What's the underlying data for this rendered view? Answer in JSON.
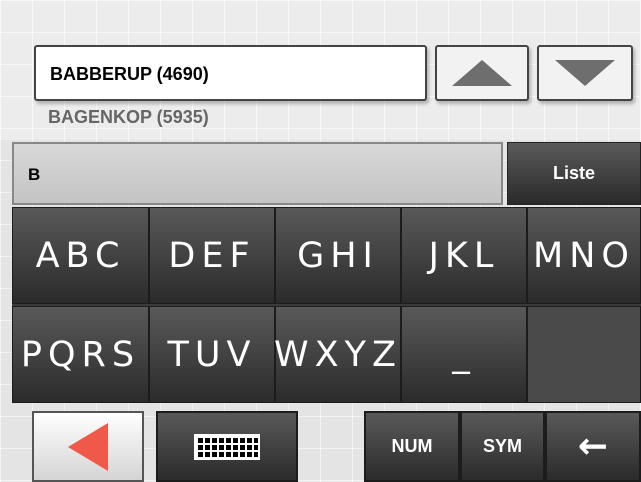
{
  "search": {
    "selected_result": "BABBERUP (4690)",
    "next_result": "BAGENKOP (5935)",
    "input_value": "B",
    "list_button": "Liste"
  },
  "scroll": {
    "up_icon": "triangle-up-icon",
    "down_icon": "triangle-down-icon"
  },
  "keypad": {
    "keys": [
      "ABC",
      "DEF",
      "GHI",
      "JKL",
      "MNO",
      "PQRS",
      "TUV",
      "WXYZ",
      "_"
    ]
  },
  "bottom": {
    "back_icon": "triangle-left-icon",
    "keyboard_icon": "keyboard-grid-icon",
    "num_label": "NUM",
    "sym_label": "SYM",
    "backspace_icon": "backspace-arrow-icon",
    "backspace_glyph": "←"
  },
  "colors": {
    "back_arrow": "#f0584a",
    "key_bg": "#3a3a3a",
    "page_bg": "#e4e4e4"
  }
}
